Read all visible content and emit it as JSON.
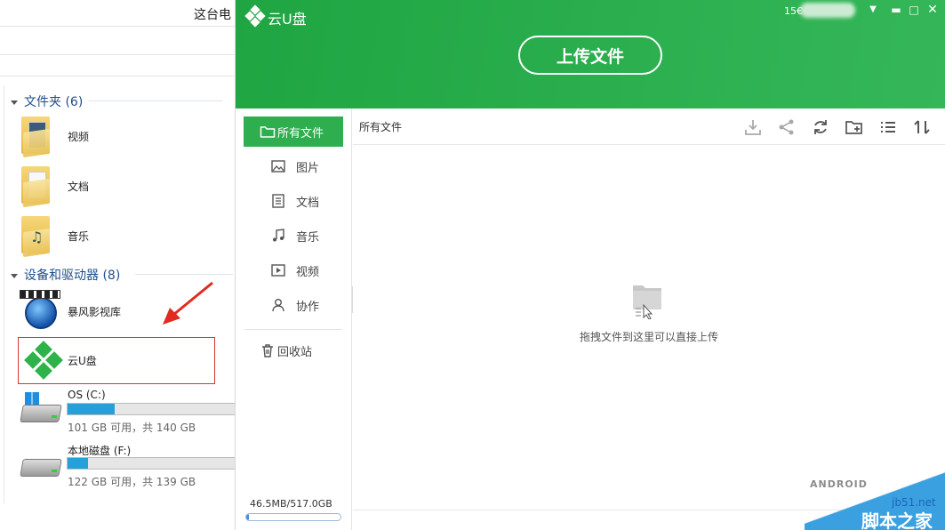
{
  "explorer": {
    "title": "这台电",
    "sections": {
      "folders": "文件夹 (6)",
      "devices": "设备和驱动器 (8)"
    },
    "folders": [
      {
        "label": "视频",
        "icon": "video-folder-icon"
      },
      {
        "label": "文档",
        "icon": "documents-folder-icon"
      },
      {
        "label": "音乐",
        "icon": "music-folder-icon"
      }
    ],
    "devices": {
      "storm": {
        "label": "暴风影视库",
        "icon": "storm-video-library-icon"
      },
      "yun": {
        "label": "云U盘",
        "icon": "yun-u-pan-icon"
      }
    },
    "drives": [
      {
        "name": "OS (C:)",
        "info": "101 GB 可用，共 140 GB",
        "used_fraction": 0.28
      },
      {
        "name": "本地磁盘 (F:)",
        "info": "122 GB 可用，共 139 GB",
        "used_fraction": 0.12
      }
    ]
  },
  "app": {
    "name": "云U盘",
    "user_id": "15€",
    "upload_label": "上传文件",
    "nav": [
      {
        "label": "所有文件",
        "icon": "folder-icon",
        "active": true
      },
      {
        "label": "图片",
        "icon": "image-icon"
      },
      {
        "label": "文档",
        "icon": "document-icon"
      },
      {
        "label": "音乐",
        "icon": "music-note-icon"
      },
      {
        "label": "视频",
        "icon": "video-play-icon"
      },
      {
        "label": "协作",
        "icon": "user-icon"
      }
    ],
    "trash": {
      "label": "回收站",
      "icon": "trash-icon"
    },
    "storage": {
      "text": "46.5MB/517.0GB",
      "used_fraction": 0.02
    },
    "breadcrumb": "所有文件",
    "toolbar_icons": [
      "download-icon",
      "share-icon",
      "refresh-icon",
      "new-folder-icon",
      "list-view-icon",
      "sort-icon"
    ],
    "empty_text": "拖拽文件到这里可以直接上传",
    "colors": {
      "brand_green": "#2eae4e",
      "accent_blue": "#3c8ce7"
    }
  },
  "watermark": {
    "android": "ANDROID",
    "site": "jb51.net",
    "cn": "脚本之家"
  }
}
